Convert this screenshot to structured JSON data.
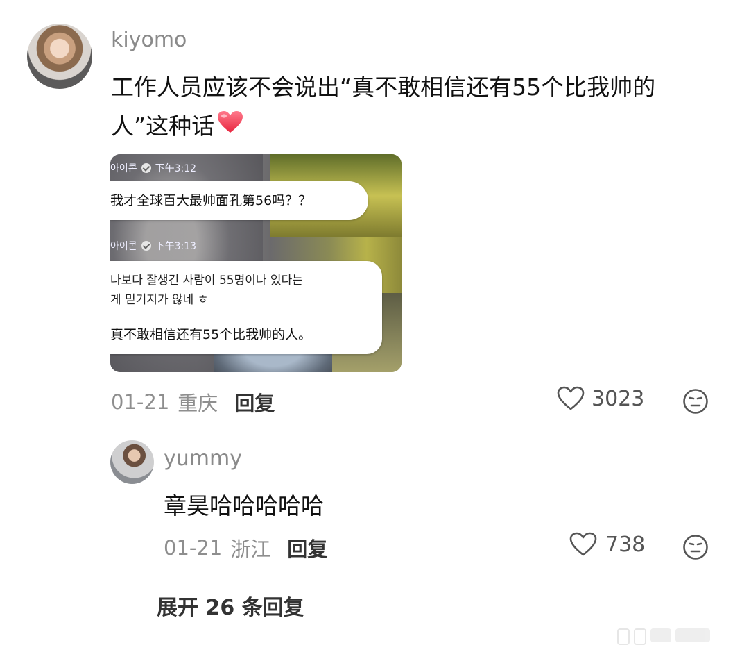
{
  "comment": {
    "username": "kiyomo",
    "text_line1": "工作人员应该不会说出“真不敢相信还有55个比我帅的",
    "text_line2": "人”这种话",
    "date": "01-21",
    "location": "重庆",
    "reply_label": "回复",
    "likes": "3023",
    "screenshot": {
      "msg1_sender": "아이콘",
      "msg1_time": "下午3:12",
      "msg1_text": "我才全球百大最帅面孔第56吗？？",
      "msg2_sender": "아이콘",
      "msg2_time": "下午3:13",
      "msg2_korean_line1": "나보다 잘생긴 사람이 55명이나 있다는",
      "msg2_korean_line2": "게 믿기지가 않네 ㅎ",
      "msg2_translation": "真不敢相信还有55个比我帅的人。"
    }
  },
  "reply": {
    "username": "yummy",
    "text": "章昊哈哈哈哈哈",
    "date": "01-21",
    "location": "浙江",
    "reply_label": "回复",
    "likes": "738"
  },
  "expand_label": "展开 26 条回复",
  "icons": {
    "heart": "heart-emoji",
    "like": "heart-outline-icon",
    "react": "neutral-face-icon"
  },
  "colors": {
    "username": "#8a8a8a",
    "heart_emoji": "#f0405c"
  }
}
